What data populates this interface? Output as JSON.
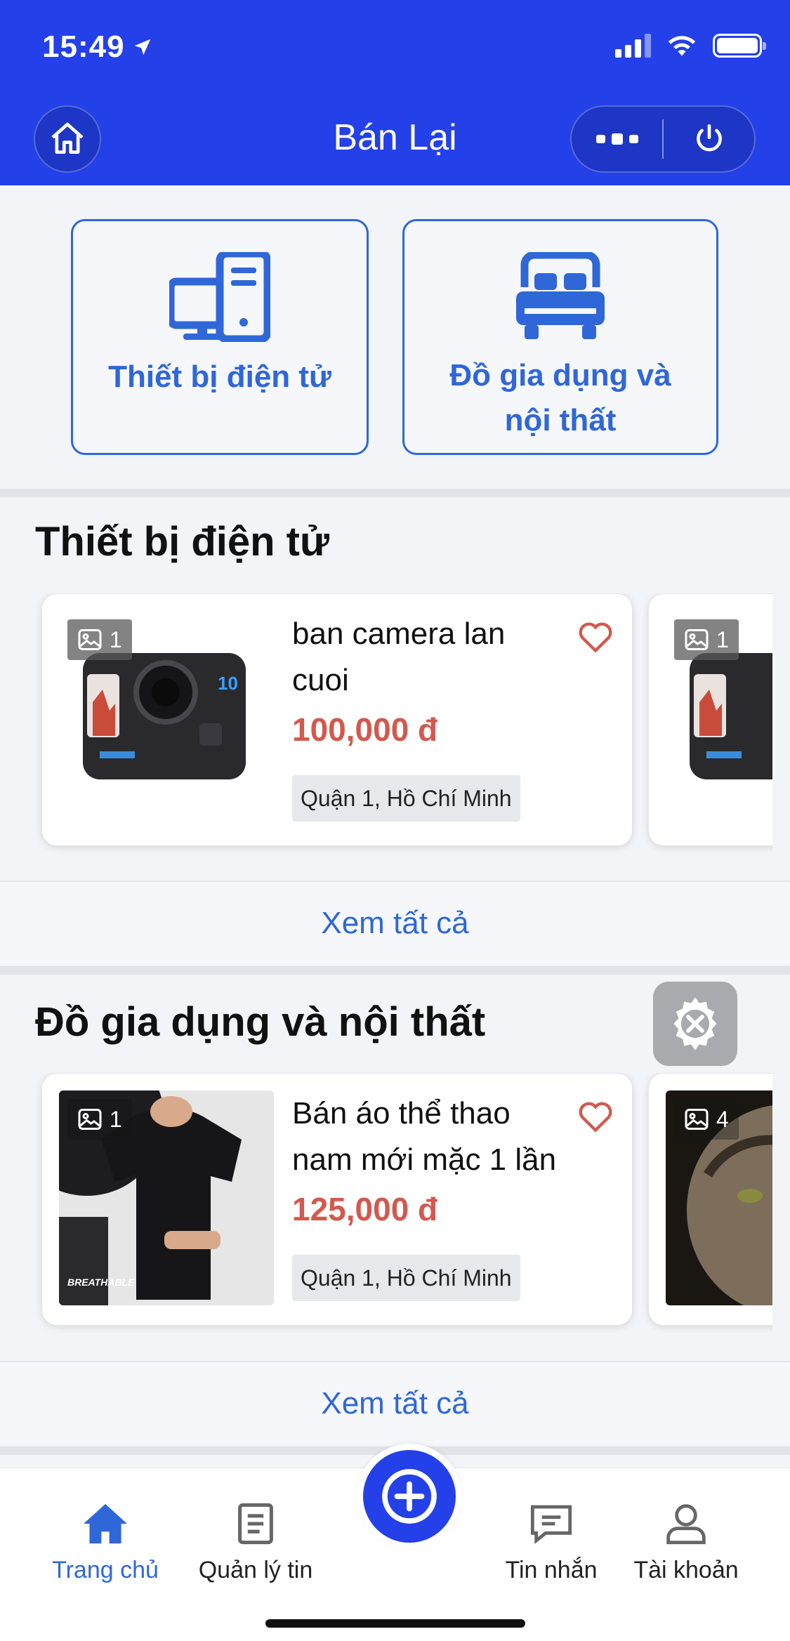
{
  "status_bar": {
    "time": "15:49"
  },
  "header": {
    "title": "Bán Lại"
  },
  "categories": [
    {
      "label": "Thiết bị điện tử",
      "icon": "computer-icon"
    },
    {
      "label": "Đồ gia dụng và nội thất",
      "icon": "bed-icon"
    }
  ],
  "sections": [
    {
      "title": "Thiết bị điện tử",
      "products": [
        {
          "title": "ban camera lan cuoi",
          "price": "100,000 đ",
          "location": "Quận 1, Hồ Chí Minh",
          "image_count": "1"
        },
        {
          "image_count": "1"
        }
      ],
      "see_all": "Xem tất cả"
    },
    {
      "title": "Đồ gia dụng và nội thất",
      "products": [
        {
          "title": "Bán áo thể thao nam mới mặc 1 lần",
          "price": "125,000 đ",
          "location": "Quận 1, Hồ Chí Minh",
          "image_count": "1"
        },
        {
          "image_count": "4"
        }
      ],
      "see_all": "Xem tất cả"
    }
  ],
  "bottom_nav": [
    {
      "label": "Trang chủ",
      "icon": "home-icon",
      "active": true
    },
    {
      "label": "Quản lý tin",
      "icon": "document-icon"
    },
    {
      "label": "Tin nhắn",
      "icon": "chat-icon"
    },
    {
      "label": "Tài khoản",
      "icon": "user-icon"
    }
  ],
  "colors": {
    "brand": "#2440e8",
    "accent": "#2f67d8",
    "price": "#d2594e"
  }
}
